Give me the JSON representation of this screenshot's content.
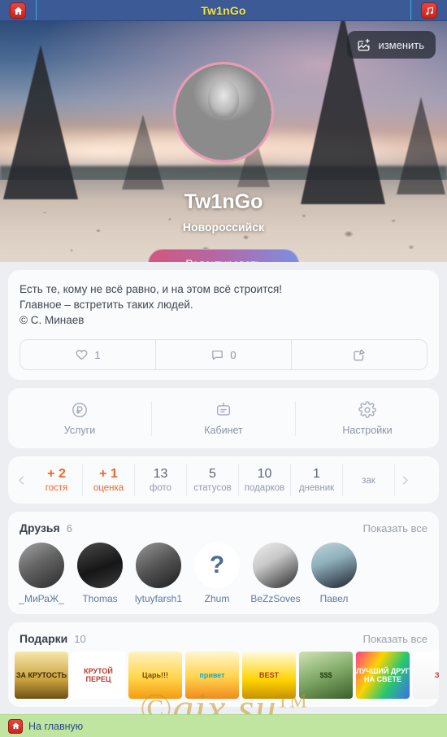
{
  "topbar": {
    "title": "Tw1nGo",
    "home_icon": "home-icon",
    "music_icon": "music-note-icon"
  },
  "cover": {
    "edit_button_label": "изменить",
    "edit_button_icon": "image-edit-icon"
  },
  "profile": {
    "name": "Tw1nGo",
    "city": "Новороссийск",
    "edit_button_label": "Редактировать",
    "avatar_ring_color": "#e79bb4"
  },
  "status": {
    "text_line1": "Есть те, кому не всё равно, и на этом всё строится!",
    "text_line2": "Главное – встретить таких людей.",
    "text_line3": "© С. Минаев",
    "likes": "1",
    "comments": "0",
    "like_icon": "heart-icon",
    "comment_icon": "comment-icon",
    "edit_icon": "edit-square-icon"
  },
  "menu": {
    "items": [
      {
        "label": "Услуги",
        "icon": "ruble-circle-icon"
      },
      {
        "label": "Кабинет",
        "icon": "cabinet-icon"
      },
      {
        "label": "Настройки",
        "icon": "gear-icon"
      }
    ]
  },
  "stats": {
    "prev_icon": "chevron-left-icon",
    "next_icon": "chevron-right-icon",
    "items": [
      {
        "value": "+ 2",
        "label": "гостя",
        "highlight": true
      },
      {
        "value": "+ 1",
        "label": "оценка",
        "highlight": true
      },
      {
        "value": "13",
        "label": "фото",
        "highlight": false
      },
      {
        "value": "5",
        "label": "статусов",
        "highlight": false
      },
      {
        "value": "10",
        "label": "подарков",
        "highlight": false
      },
      {
        "value": "1",
        "label": "дневник",
        "highlight": false
      },
      {
        "value": "",
        "label": "зак",
        "highlight": false
      }
    ]
  },
  "friends": {
    "title": "Друзья",
    "count": "6",
    "show_all": "Показать все",
    "items": [
      {
        "name": "_МиРаЖ_"
      },
      {
        "name": "Thomas"
      },
      {
        "name": "lytuyfarsh1"
      },
      {
        "name": "Zhum",
        "placeholder": "?"
      },
      {
        "name": "BeZzSoves"
      },
      {
        "name": "Павел"
      }
    ]
  },
  "gifts": {
    "title": "Подарки",
    "count": "10",
    "show_all": "Показать все",
    "items": [
      {
        "caption": "ЗА КРУТОСТЬ"
      },
      {
        "caption": "КРУТОЙ ПЕРЕЦ"
      },
      {
        "caption": "Царь!!!"
      },
      {
        "caption": "привет"
      },
      {
        "caption": "BEST"
      },
      {
        "caption": "$$$"
      },
      {
        "caption": "ЛУЧШИЙ ДРУГ НА СВЕТЕ"
      },
      {
        "caption": "ЗА"
      }
    ]
  },
  "watermark": {
    "text": "gix.su",
    "sup": "TM"
  },
  "bottombar": {
    "link_label": "На главную",
    "home_icon": "home-icon"
  }
}
